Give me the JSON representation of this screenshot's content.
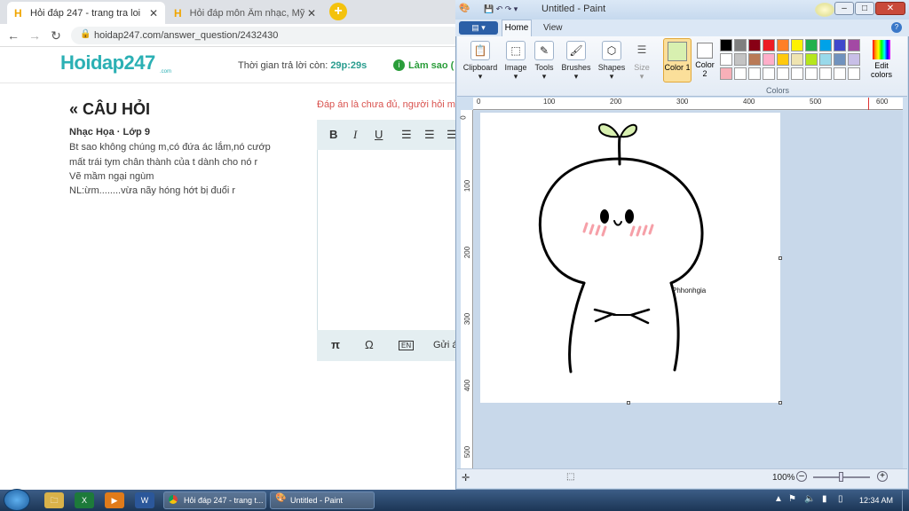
{
  "browser": {
    "tabs": [
      {
        "label": "Hỏi đáp 247 - trang tra loi",
        "active": true
      },
      {
        "label": "Hỏi đáp môn Âm nhạc, Mỹ thuật",
        "active": false
      }
    ],
    "new_tab": "+",
    "url": "hoidap247.com/answer_question/2432430",
    "site": {
      "logo": "Hoidap247",
      "logo_sub": ".com",
      "timer_label": "Thời gian trả lời còn: ",
      "timer_value": "29p:29s",
      "howto": "Làm sao (",
      "question_title": "CÂU HỎI",
      "question_subject": "Nhạc Họa · Lớp 9",
      "question_lines": [
        "Bt sao không chúng m,có đứa ác lắm,nó cướp",
        "mất trái tym chân thành của t dành cho nó r",
        "Vẽ mầm ngại ngùm",
        "NL:ừm........vừa nãy hóng hớt bị đuổi r"
      ],
      "warning": "Đáp án là chưa đủ, người hỏi m",
      "editor_top": [
        "B",
        "I",
        "U"
      ],
      "editor_bottom": [
        "π",
        "Ω",
        "EN",
        "Gửi á"
      ]
    }
  },
  "paint": {
    "title": "Untitled - Paint",
    "file_button": "▤ ▾",
    "tabs": [
      "Home",
      "View"
    ],
    "ribbon": {
      "clipboard": "Clipboard",
      "image": "Image",
      "tools": "Tools",
      "brushes": "Brushes",
      "shapes": "Shapes",
      "size": "Size",
      "color1": "Color 1",
      "color2": "Color 2",
      "edit_colors": "Edit colors",
      "colors_group": "Colors"
    },
    "palette": [
      "#000000",
      "#7f7f7f",
      "#880015",
      "#ed1c24",
      "#ff7f27",
      "#fff200",
      "#22b14c",
      "#00a2e8",
      "#3f48cc",
      "#a349a4",
      "#ffffff",
      "#c3c3c3",
      "#b97a57",
      "#ffaec9",
      "#ffc90e",
      "#efe4b0",
      "#b5e61d",
      "#99d9ea",
      "#7092be",
      "#c8bfe7"
    ],
    "ruler_h": [
      "0",
      "100",
      "200",
      "300",
      "400",
      "500",
      "600"
    ],
    "ruler_v": [
      "0",
      "100",
      "200",
      "300",
      "400",
      "500"
    ],
    "drawing_signature": "Phhonhgia",
    "zoom": "100%"
  },
  "taskbar": {
    "tasks": [
      "Hỏi đáp 247 - trang t...",
      "Untitled - Paint"
    ],
    "clock": "12:34 AM"
  }
}
